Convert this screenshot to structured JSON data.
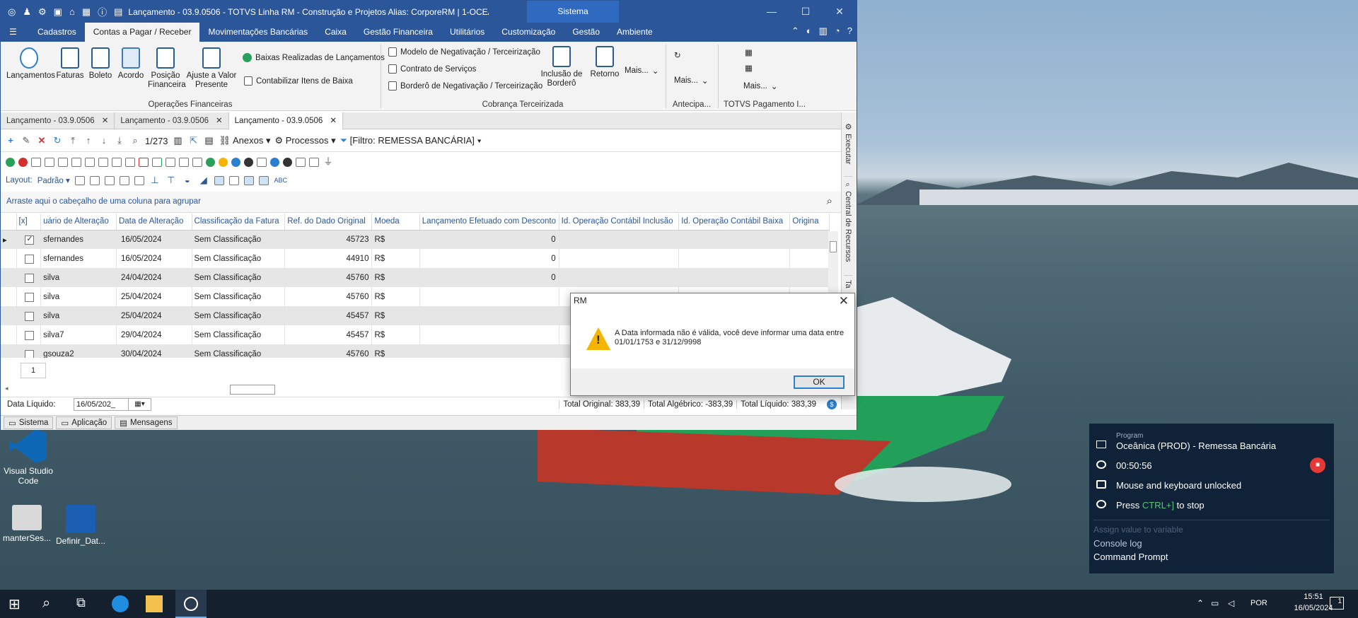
{
  "titlebar": {
    "title": "Lançamento - 03.9.0506 - TOTVS Linha RM - Construção e Projetos  Alias: CorporeRM | 1-OCEANICA ...",
    "context_tab": "Sistema"
  },
  "menu": [
    "Cadastros",
    "Contas a Pagar / Receber",
    "Movimentações Bancárias",
    "Caixa",
    "Gestão Financeira",
    "Utilitários",
    "Customização",
    "Gestão",
    "Ambiente"
  ],
  "menu_active": "Contas a Pagar / Receber",
  "ribbon": {
    "buttons": [
      "Lançamentos",
      "Faturas",
      "Boleto",
      "Acordo",
      "Posição Financeira",
      "Ajuste a Valor Presente"
    ],
    "baixas": "Baixas Realizadas de Lançamentos",
    "contabilizar": "Contabilizar Itens de Baixa",
    "group1": "Operações Financeiras",
    "modelo": "Modelo de Negativação / Terceirização",
    "contrato": "Contrato de Serviços",
    "bordero": "Borderô de Negativação / Terceirização",
    "inclusao": "Inclusão de Borderô",
    "retorno": "Retorno",
    "mais1": "Mais...",
    "group2": "Cobrança Terceirizada",
    "mais2": "Mais...",
    "group3": "Antecipa...",
    "mais3": "Mais...",
    "group4": "TOTVS Pagamento I..."
  },
  "doc_tabs": [
    "Lançamento - 03.9.0506",
    "Lançamento - 03.9.0506",
    "Lançamento - 03.9.0506"
  ],
  "side_panel": {
    "executar": "Executar",
    "central": "Central de Recursos",
    "ta": "Ta"
  },
  "toolbar": {
    "record": "1/273",
    "anexos": "Anexos",
    "processos": "Processos",
    "filter": "[Filtro: REMESSA BANCÁRIA]"
  },
  "layout": {
    "label": "Layout:",
    "value": "Padrão"
  },
  "group_hint": "Arraste aqui o cabeçalho de uma coluna para agrupar",
  "columns": [
    "[x]",
    "uário de Alteração",
    "Data de Alteração",
    "Classificação da Fatura",
    "Ref. do Dado Original",
    "Moeda",
    "Lançamento Efetuado com Desconto",
    "Id. Operação Contábil Inclusão",
    "Id. Operação Contábil Baixa",
    "Origina"
  ],
  "rows": [
    {
      "user": "sfernandes",
      "date": "16/05/2024",
      "class": "Sem Classificação",
      "ref": "45723",
      "moeda": "R$",
      "desc": "0",
      "checked": true
    },
    {
      "user": "sfernandes",
      "date": "16/05/2024",
      "class": "Sem Classificação",
      "ref": "44910",
      "moeda": "R$",
      "desc": "0",
      "checked": false
    },
    {
      "user": "silva",
      "date": "24/04/2024",
      "class": "Sem Classificação",
      "ref": "45760",
      "moeda": "R$",
      "desc": "0",
      "checked": false
    },
    {
      "user": "silva",
      "date": "25/04/2024",
      "class": "Sem Classificação",
      "ref": "45760",
      "moeda": "R$",
      "desc": "",
      "checked": false
    },
    {
      "user": "silva",
      "date": "25/04/2024",
      "class": "Sem Classificação",
      "ref": "45457",
      "moeda": "R$",
      "desc": "",
      "checked": false
    },
    {
      "user": "silva7",
      "date": "29/04/2024",
      "class": "Sem Classificação",
      "ref": "45457",
      "moeda": "R$",
      "desc": "",
      "checked": false
    },
    {
      "user": "gsouza2",
      "date": "30/04/2024",
      "class": "Sem Classificação",
      "ref": "45760",
      "moeda": "R$",
      "desc": "",
      "checked": false
    }
  ],
  "page": "1",
  "footer": {
    "label": "Data Líquido:",
    "date": "16/05/202_",
    "total_original": "Total Original: 383,39",
    "total_algebrico": "Total Algébrico: -383,39",
    "total_liquido": "Total Líquido: 383,39"
  },
  "statusbar": [
    "Sistema",
    "Aplicação",
    "Mensagens"
  ],
  "dialog": {
    "title": "RM",
    "message": "A Data informada não é válida, você deve informar uma data entre 01/01/1753 e 31/12/9998",
    "ok": "OK"
  },
  "desktop_icons": [
    "Visual Studio Code",
    "manterSes...",
    "Definir_Dat..."
  ],
  "robot": {
    "program_label": "Program",
    "program": "Oceânica (PROD) - Remessa Bancária",
    "elapsed": "00:50:56",
    "lock": "Mouse and keyboard unlocked",
    "press": "Press",
    "shortcut": "CTRL+]",
    "to_stop": "to stop",
    "assign": "Assign value to variable",
    "console": "Console log",
    "cmd": "Command Prompt"
  },
  "taskbar": {
    "lang": "POR",
    "time": "15:51",
    "date": "16/05/2024",
    "notif": "1"
  }
}
